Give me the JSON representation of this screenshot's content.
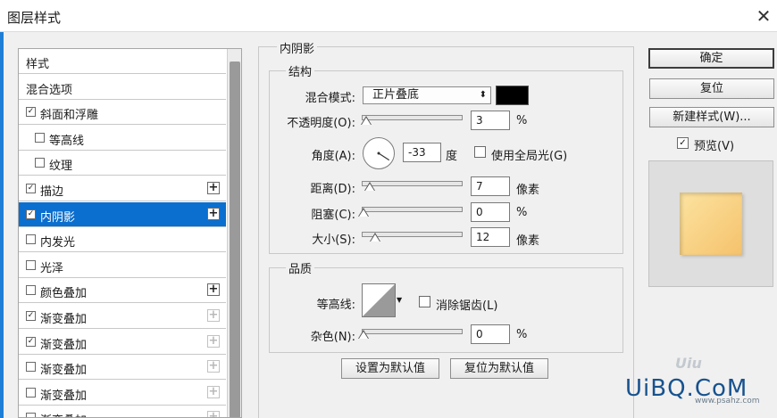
{
  "window": {
    "title": "图层样式",
    "close_glyph": "✕"
  },
  "style_list": {
    "items": [
      {
        "label": "样式",
        "checkbox": false,
        "indent": 0,
        "plus": "none",
        "checked": false,
        "selected": false
      },
      {
        "label": "混合选项",
        "checkbox": false,
        "indent": 0,
        "plus": "none",
        "checked": false,
        "selected": false
      },
      {
        "label": "斜面和浮雕",
        "checkbox": true,
        "indent": 0,
        "plus": "none",
        "checked": true,
        "selected": false
      },
      {
        "label": "等高线",
        "checkbox": true,
        "indent": 1,
        "plus": "none",
        "checked": false,
        "selected": false
      },
      {
        "label": "纹理",
        "checkbox": true,
        "indent": 1,
        "plus": "none",
        "checked": false,
        "selected": false
      },
      {
        "label": "描边",
        "checkbox": true,
        "indent": 0,
        "plus": "active",
        "checked": true,
        "selected": false
      },
      {
        "label": "内阴影",
        "checkbox": true,
        "indent": 0,
        "plus": "active",
        "checked": true,
        "selected": true
      },
      {
        "label": "内发光",
        "checkbox": true,
        "indent": 0,
        "plus": "none",
        "checked": false,
        "selected": false
      },
      {
        "label": "光泽",
        "checkbox": true,
        "indent": 0,
        "plus": "none",
        "checked": false,
        "selected": false
      },
      {
        "label": "颜色叠加",
        "checkbox": true,
        "indent": 0,
        "plus": "active",
        "checked": false,
        "selected": false
      },
      {
        "label": "渐变叠加",
        "checkbox": true,
        "indent": 0,
        "plus": "dim",
        "checked": true,
        "selected": false
      },
      {
        "label": "渐变叠加",
        "checkbox": true,
        "indent": 0,
        "plus": "dim",
        "checked": true,
        "selected": false
      },
      {
        "label": "渐变叠加",
        "checkbox": true,
        "indent": 0,
        "plus": "dim",
        "checked": false,
        "selected": false
      },
      {
        "label": "渐变叠加",
        "checkbox": true,
        "indent": 0,
        "plus": "dim",
        "checked": false,
        "selected": false
      },
      {
        "label": "渐变叠加",
        "checkbox": true,
        "indent": 0,
        "plus": "dim",
        "checked": false,
        "selected": false
      }
    ]
  },
  "panel": {
    "section_title": "内阴影",
    "structure": {
      "title": "结构",
      "blend_mode_label": "混合模式:",
      "blend_mode_value": "正片叠底",
      "blend_color": "#000000",
      "opacity_label": "不透明度(O):",
      "opacity_value": "3",
      "opacity_unit": "%",
      "opacity_level": 0.03,
      "angle_label": "角度(A):",
      "angle_value": "-33",
      "angle_unit": "度",
      "global_light_label": "使用全局光(G)",
      "global_light_checked": false,
      "distance_label": "距离(D):",
      "distance_value": "7",
      "distance_unit": "像素",
      "distance_level": 0.07,
      "choke_label": "阻塞(C):",
      "choke_value": "0",
      "choke_unit": "%",
      "choke_level": 0.0,
      "size_label": "大小(S):",
      "size_value": "12",
      "size_unit": "像素",
      "size_level": 0.12
    },
    "quality": {
      "title": "品质",
      "contour_label": "等高线:",
      "anti_alias_label": "消除锯齿(L)",
      "anti_alias_checked": false,
      "noise_label": "杂色(N):",
      "noise_value": "0",
      "noise_unit": "%",
      "noise_level": 0.0
    },
    "make_default_label": "设置为默认值",
    "reset_default_label": "复位为默认值"
  },
  "buttons": {
    "ok": "确定",
    "reset": "复位",
    "new_style": "新建样式(W)...",
    "preview_label": "预览(V)",
    "preview_checked": true
  },
  "preview": {
    "swatch_from": "#fce3a0",
    "swatch_to": "#f5c26c"
  },
  "watermark": {
    "main": "UiBQ.CoM",
    "faint": "Uiu",
    "sub": "www.psahz.com"
  },
  "colors": {
    "accent": "#0b6fcf",
    "window_bg": "#f0f0f0"
  }
}
